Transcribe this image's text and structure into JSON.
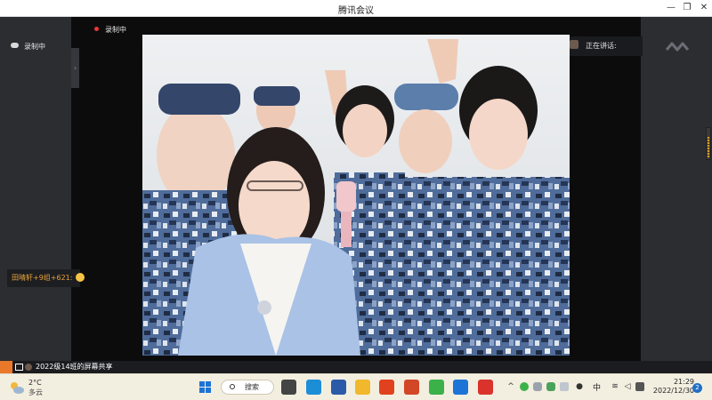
{
  "window": {
    "title": "腾讯会议",
    "minimize_glyph": "—",
    "maximize_glyph": "❐",
    "close_glyph": "✕"
  },
  "meeting": {
    "recording_label": "录制中",
    "recording_label_top": "录制中",
    "speaking_label": "正在讲话:",
    "collapse_glyph": "›",
    "volume_level": 0.72,
    "chat_message": "田晴轩+9组+621:",
    "share_label": "2022级14班的屏幕共享"
  },
  "taskbar": {
    "weather": {
      "temp": "2°C",
      "desc": "多云",
      "icon": "cloud-sun-icon"
    },
    "search_label": "搜索",
    "apps": [
      {
        "name": "start-button",
        "icon": "windows-logo-icon",
        "color": "#1e73d6"
      },
      {
        "name": "task-view-button",
        "icon": "task-view-icon",
        "color": "#444444"
      },
      {
        "name": "edge-app",
        "icon": "edge-icon",
        "color": "#1c8ed6"
      },
      {
        "name": "word-app",
        "icon": "word-icon",
        "color": "#2b5aa8"
      },
      {
        "name": "file-explorer-app",
        "icon": "folder-icon",
        "color": "#f1b82d"
      },
      {
        "name": "office-app",
        "icon": "office-icon",
        "color": "#e0421d"
      },
      {
        "name": "powerpoint-app",
        "icon": "powerpoint-icon",
        "color": "#d24726"
      },
      {
        "name": "browser-app",
        "icon": "browser-icon",
        "color": "#3cb14a"
      },
      {
        "name": "tencent-meeting-app",
        "icon": "tencent-meeting-icon",
        "color": "#1e73d6"
      },
      {
        "name": "wps-app",
        "icon": "wps-icon",
        "color": "#d9332c"
      }
    ],
    "tray": {
      "ime": "中",
      "time": "21:29",
      "date": "2022/12/30",
      "notification_count": "2"
    }
  }
}
